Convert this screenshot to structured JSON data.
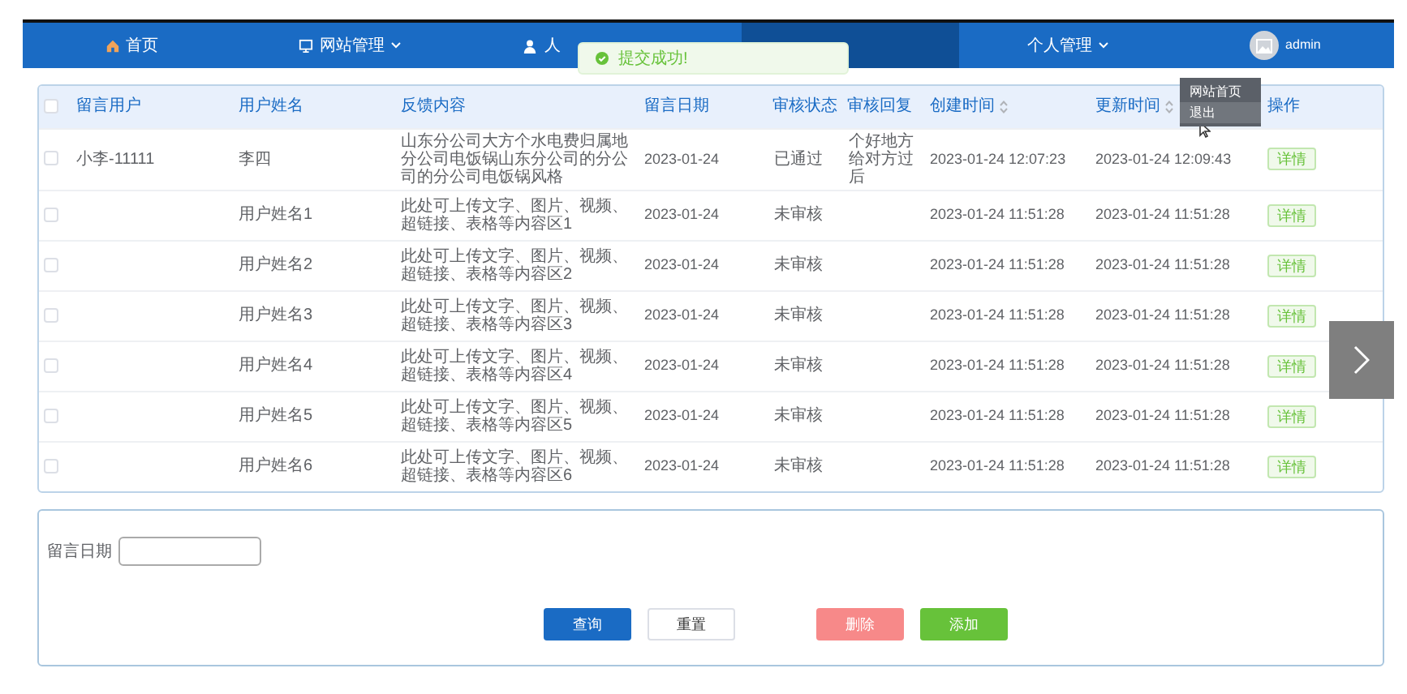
{
  "nav": {
    "items": [
      {
        "label": "首页",
        "caret": false,
        "selected": false
      },
      {
        "label": "网站管理",
        "caret": true,
        "selected": false
      },
      {
        "label": "人",
        "caret": false,
        "selected": false
      },
      {
        "caret": false,
        "selected": true
      },
      {
        "label": "个人管理",
        "caret": true,
        "selected": false
      }
    ],
    "user": {
      "name": "admin"
    },
    "user_menu": [
      {
        "label": "网站首页",
        "selected": false
      },
      {
        "label": "退出",
        "selected": true
      }
    ]
  },
  "toast": {
    "message": "提交成功!"
  },
  "table": {
    "columns": [
      "留言用户",
      "用户姓名",
      "反馈内容",
      "留言日期",
      "审核状态",
      "审核回复",
      "创建时间",
      "更新时间",
      "操作"
    ],
    "sortable": [
      false,
      false,
      false,
      false,
      false,
      false,
      true,
      true,
      false
    ],
    "header_checked": false,
    "rows": [
      {
        "checked": false,
        "cells": [
          "小李-11111",
          "李四",
          "山东分公司大方个水电费归属地分公司电饭锅山东分公司的分公司的分公司电饭锅风格",
          "2023-01-24",
          "已通过",
          "个好地方给对方过后",
          "2023-01-24 12:07:23",
          "2023-01-24 12:09:43"
        ],
        "action": "详情"
      },
      {
        "checked": false,
        "cells": [
          "",
          "用户姓名1",
          "此处可上传文字、图片、视频、超链接、表格等内容区1",
          "2023-01-24",
          "未审核",
          "",
          "2023-01-24 11:51:28",
          "2023-01-24 11:51:28"
        ],
        "action": "详情"
      },
      {
        "checked": false,
        "cells": [
          "",
          "用户姓名2",
          "此处可上传文字、图片、视频、超链接、表格等内容区2",
          "2023-01-24",
          "未审核",
          "",
          "2023-01-24 11:51:28",
          "2023-01-24 11:51:28"
        ],
        "action": "详情"
      },
      {
        "checked": false,
        "cells": [
          "",
          "用户姓名3",
          "此处可上传文字、图片、视频、超链接、表格等内容区3",
          "2023-01-24",
          "未审核",
          "",
          "2023-01-24 11:51:28",
          "2023-01-24 11:51:28"
        ],
        "action": "详情"
      },
      {
        "checked": false,
        "cells": [
          "",
          "用户姓名4",
          "此处可上传文字、图片、视频、超链接、表格等内容区4",
          "2023-01-24",
          "未审核",
          "",
          "2023-01-24 11:51:28",
          "2023-01-24 11:51:28"
        ],
        "action": "详情"
      },
      {
        "checked": false,
        "cells": [
          "",
          "用户姓名5",
          "此处可上传文字、图片、视频、超链接、表格等内容区5",
          "2023-01-24",
          "未审核",
          "",
          "2023-01-24 11:51:28",
          "2023-01-24 11:51:28"
        ],
        "action": "详情"
      },
      {
        "checked": false,
        "cells": [
          "",
          "用户姓名6",
          "此处可上传文字、图片、视频、超链接、表格等内容区6",
          "2023-01-24",
          "未审核",
          "",
          "2023-01-24 11:51:28",
          "2023-01-24 11:51:28"
        ],
        "action": "详情"
      }
    ]
  },
  "search": {
    "label": "留言日期"
  },
  "buttons": [
    {
      "label": "查询",
      "kind": "primary"
    },
    {
      "label": "重置",
      "kind": "plain"
    },
    {
      "label": "删除",
      "kind": "danger"
    },
    {
      "label": "添加",
      "kind": "success"
    }
  ]
}
